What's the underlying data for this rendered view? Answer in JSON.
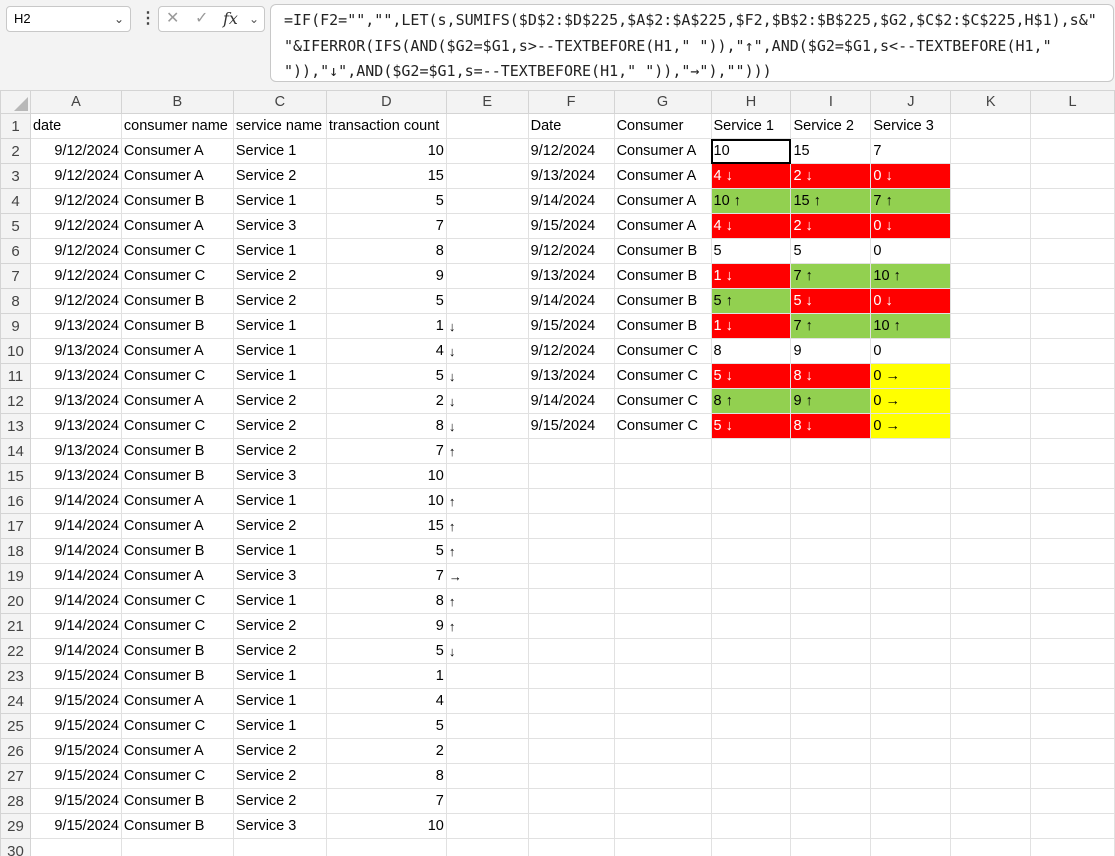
{
  "name_box": {
    "value": "H2"
  },
  "formula_buttons": {
    "cancel": "✕",
    "enter": "✓",
    "fx": "fx"
  },
  "formula_bar": {
    "text": "=IF(F2=\"\",\"\",LET(s,SUMIFS($D$2:$D$225,$A$2:$A$225,$F2,$B$2:$B$225,$G2,$C$2:$C$225,H$1),s&\" \"&IFERROR(IFS(AND($G2=$G1,s>--TEXTBEFORE(H1,\" \")),\"↑\",AND($G2=$G1,s<--TEXTBEFORE(H1,\" \")),\"↓\",AND($G2=$G1,s=--TEXTBEFORE(H1,\" \")),\"→\"),\"\")))"
  },
  "columns": [
    "A",
    "B",
    "C",
    "D",
    "E",
    "F",
    "G",
    "H",
    "I",
    "J",
    "K",
    "L"
  ],
  "rows": [
    {
      "n": "1",
      "a": "date",
      "b": "consumer name",
      "c": "service name",
      "d": "transaction count",
      "e": "",
      "f": "Date",
      "g": "Consumer",
      "h": "Service 1",
      "i": "Service 2",
      "j": "Service 3"
    },
    {
      "n": "2",
      "a": "9/12/2024",
      "b": "Consumer A",
      "c": "Service 1",
      "d": "10",
      "e": "",
      "f": "9/12/2024",
      "g": "Consumer A",
      "h": "10",
      "i": "15",
      "j": "7"
    },
    {
      "n": "3",
      "a": "9/12/2024",
      "b": "Consumer A",
      "c": "Service 2",
      "d": "15",
      "e": "",
      "f": "9/13/2024",
      "g": "Consumer A",
      "h": "4 ↓",
      "i": "2 ↓",
      "j": "0 ↓"
    },
    {
      "n": "4",
      "a": "9/12/2024",
      "b": "Consumer B",
      "c": "Service 1",
      "d": "5",
      "e": "",
      "f": "9/14/2024",
      "g": "Consumer A",
      "h": "10 ↑",
      "i": "15 ↑",
      "j": "7 ↑"
    },
    {
      "n": "5",
      "a": "9/12/2024",
      "b": "Consumer A",
      "c": "Service 3",
      "d": "7",
      "e": "",
      "f": "9/15/2024",
      "g": "Consumer A",
      "h": "4 ↓",
      "i": "2 ↓",
      "j": "0 ↓"
    },
    {
      "n": "6",
      "a": "9/12/2024",
      "b": "Consumer C",
      "c": "Service 1",
      "d": "8",
      "e": "",
      "f": "9/12/2024",
      "g": "Consumer B",
      "h": "5",
      "i": "5",
      "j": "0"
    },
    {
      "n": "7",
      "a": "9/12/2024",
      "b": "Consumer C",
      "c": "Service 2",
      "d": "9",
      "e": "",
      "f": "9/13/2024",
      "g": "Consumer B",
      "h": "1 ↓",
      "i": "7 ↑",
      "j": "10 ↑"
    },
    {
      "n": "8",
      "a": "9/12/2024",
      "b": "Consumer B",
      "c": "Service 2",
      "d": "5",
      "e": "",
      "f": "9/14/2024",
      "g": "Consumer B",
      "h": "5 ↑",
      "i": "5 ↓",
      "j": "0 ↓"
    },
    {
      "n": "9",
      "a": "9/13/2024",
      "b": "Consumer B",
      "c": "Service 1",
      "d": "1",
      "e": "↓",
      "f": "9/15/2024",
      "g": "Consumer B",
      "h": "1 ↓",
      "i": "7 ↑",
      "j": "10 ↑"
    },
    {
      "n": "10",
      "a": "9/13/2024",
      "b": "Consumer A",
      "c": "Service 1",
      "d": "4",
      "e": "↓",
      "f": "9/12/2024",
      "g": "Consumer C",
      "h": "8",
      "i": "9",
      "j": "0"
    },
    {
      "n": "11",
      "a": "9/13/2024",
      "b": "Consumer C",
      "c": "Service 1",
      "d": "5",
      "e": "↓",
      "f": "9/13/2024",
      "g": "Consumer C",
      "h": "5 ↓",
      "i": "8 ↓",
      "j": "0 →"
    },
    {
      "n": "12",
      "a": "9/13/2024",
      "b": "Consumer A",
      "c": "Service 2",
      "d": "2",
      "e": "↓",
      "f": "9/14/2024",
      "g": "Consumer C",
      "h": "8 ↑",
      "i": "9 ↑",
      "j": "0 →"
    },
    {
      "n": "13",
      "a": "9/13/2024",
      "b": "Consumer C",
      "c": "Service 2",
      "d": "8",
      "e": "↓",
      "f": "9/15/2024",
      "g": "Consumer C",
      "h": "5 ↓",
      "i": "8 ↓",
      "j": "0 →"
    },
    {
      "n": "14",
      "a": "9/13/2024",
      "b": "Consumer B",
      "c": "Service 2",
      "d": "7",
      "e": "↑",
      "f": "",
      "g": "",
      "h": "",
      "i": "",
      "j": ""
    },
    {
      "n": "15",
      "a": "9/13/2024",
      "b": "Consumer B",
      "c": "Service 3",
      "d": "10",
      "e": "",
      "f": "",
      "g": "",
      "h": "",
      "i": "",
      "j": ""
    },
    {
      "n": "16",
      "a": "9/14/2024",
      "b": "Consumer A",
      "c": "Service 1",
      "d": "10",
      "e": "↑",
      "f": "",
      "g": "",
      "h": "",
      "i": "",
      "j": ""
    },
    {
      "n": "17",
      "a": "9/14/2024",
      "b": "Consumer A",
      "c": "Service 2",
      "d": "15",
      "e": "↑",
      "f": "",
      "g": "",
      "h": "",
      "i": "",
      "j": ""
    },
    {
      "n": "18",
      "a": "9/14/2024",
      "b": "Consumer B",
      "c": "Service 1",
      "d": "5",
      "e": "↑",
      "f": "",
      "g": "",
      "h": "",
      "i": "",
      "j": ""
    },
    {
      "n": "19",
      "a": "9/14/2024",
      "b": "Consumer A",
      "c": "Service 3",
      "d": "7",
      "e": "→",
      "f": "",
      "g": "",
      "h": "",
      "i": "",
      "j": ""
    },
    {
      "n": "20",
      "a": "9/14/2024",
      "b": "Consumer C",
      "c": "Service 1",
      "d": "8",
      "e": "↑",
      "f": "",
      "g": "",
      "h": "",
      "i": "",
      "j": ""
    },
    {
      "n": "21",
      "a": "9/14/2024",
      "b": "Consumer C",
      "c": "Service 2",
      "d": "9",
      "e": "↑",
      "f": "",
      "g": "",
      "h": "",
      "i": "",
      "j": ""
    },
    {
      "n": "22",
      "a": "9/14/2024",
      "b": "Consumer B",
      "c": "Service 2",
      "d": "5",
      "e": "↓",
      "f": "",
      "g": "",
      "h": "",
      "i": "",
      "j": ""
    },
    {
      "n": "23",
      "a": "9/15/2024",
      "b": "Consumer B",
      "c": "Service 1",
      "d": "1",
      "e": "",
      "f": "",
      "g": "",
      "h": "",
      "i": "",
      "j": ""
    },
    {
      "n": "24",
      "a": "9/15/2024",
      "b": "Consumer A",
      "c": "Service 1",
      "d": "4",
      "e": "",
      "f": "",
      "g": "",
      "h": "",
      "i": "",
      "j": ""
    },
    {
      "n": "25",
      "a": "9/15/2024",
      "b": "Consumer C",
      "c": "Service 1",
      "d": "5",
      "e": "",
      "f": "",
      "g": "",
      "h": "",
      "i": "",
      "j": ""
    },
    {
      "n": "26",
      "a": "9/15/2024",
      "b": "Consumer A",
      "c": "Service 2",
      "d": "2",
      "e": "",
      "f": "",
      "g": "",
      "h": "",
      "i": "",
      "j": ""
    },
    {
      "n": "27",
      "a": "9/15/2024",
      "b": "Consumer C",
      "c": "Service 2",
      "d": "8",
      "e": "",
      "f": "",
      "g": "",
      "h": "",
      "i": "",
      "j": ""
    },
    {
      "n": "28",
      "a": "9/15/2024",
      "b": "Consumer B",
      "c": "Service 2",
      "d": "7",
      "e": "",
      "f": "",
      "g": "",
      "h": "",
      "i": "",
      "j": ""
    },
    {
      "n": "29",
      "a": "9/15/2024",
      "b": "Consumer B",
      "c": "Service 3",
      "d": "10",
      "e": "",
      "f": "",
      "g": "",
      "h": "",
      "i": "",
      "j": ""
    },
    {
      "n": "30",
      "a": "",
      "b": "",
      "c": "",
      "d": "",
      "e": "",
      "f": "",
      "g": "",
      "h": "",
      "i": "",
      "j": ""
    }
  ],
  "fills": {
    "red": "#ff0000",
    "green": "#92d050",
    "yellow": "#ffff00"
  },
  "fill_map": [
    [],
    [
      "",
      "",
      ""
    ],
    [
      "red",
      "red",
      "red"
    ],
    [
      "green",
      "green",
      "green"
    ],
    [
      "red",
      "red",
      "red"
    ],
    [
      "",
      "",
      ""
    ],
    [
      "red",
      "green",
      "green"
    ],
    [
      "green",
      "red",
      "red"
    ],
    [
      "red",
      "green",
      "green"
    ],
    [
      "",
      "",
      ""
    ],
    [
      "red",
      "red",
      "yellow"
    ],
    [
      "green",
      "green",
      "yellow"
    ],
    [
      "red",
      "red",
      "yellow"
    ]
  ],
  "selected_cell": "H2"
}
